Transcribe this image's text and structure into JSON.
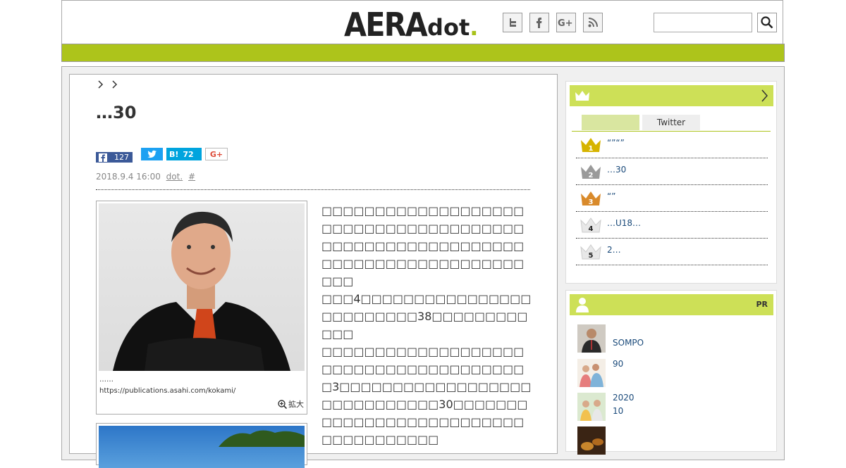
{
  "header": {
    "logo_main": "AERA",
    "logo_sub": "dot",
    "logo_period": ".",
    "social": [
      "twitter-icon",
      "facebook-icon",
      "google-plus-icon",
      "rss-icon"
    ],
    "search_placeholder": ""
  },
  "breadcrumb": {
    "sep1": ">",
    "sep2": ">"
  },
  "article": {
    "title": "…30",
    "share": {
      "facebook_count": "127",
      "hatena_label": "B!",
      "hatena_count": "72",
      "gplus_label": "G+"
    },
    "date": "2018.9.4 16:00",
    "source": "dot.",
    "hash": "#",
    "photo_caption": "……",
    "photo_url": "https://publications.asahi.com/kokami/",
    "zoom_label": "拡大",
    "paragraphs": [
      "□□□□□□□□□□□□□□□□□□□□□□□□□□□□□□□□□□□□□□□□□□□□□□□□□□□□□□□□□□□□□□□□□□□□□□□□□□□□□□□",
      "□□□4□□□□□□□□□□□□□□□□□□□□□□□□□38□□□□□□□□□□□□",
      "□□□□□□□□□□□□□□□□□□□□□□□□□□□□□□□□□□□□□□□3□□□□□□□□□□□□□□□□□□□□□□□□□□□□□30□□□□□□□□□□□□□□□□□□□□□□□□□□□□□□□□□□□□□"
    ]
  },
  "ranking": {
    "tab_active": "",
    "tab_twitter": "Twitter",
    "items": [
      {
        "rank": "1",
        "text": "“”“”",
        "color": "#d6b400"
      },
      {
        "rank": "2",
        "text": "…30",
        "color": "#9a9a9a"
      },
      {
        "rank": "3",
        "text": "“”",
        "color": "#d98a2b"
      },
      {
        "rank": "4",
        "text": "…U18…",
        "color": "#e8e8e8"
      },
      {
        "rank": "5",
        "text": "2…",
        "color": "#e8e8e8"
      }
    ]
  },
  "pr": {
    "label": "PR",
    "items": [
      {
        "line1": "",
        "line2": "SOMPO"
      },
      {
        "line1": "90",
        "line2": ""
      },
      {
        "line1": "2020",
        "line2": "10"
      },
      {
        "line1": "",
        "line2": ""
      }
    ]
  },
  "colors": {
    "accent_green": "#adc41b",
    "panel_green": "#cde057",
    "link": "#1a4a7a"
  }
}
